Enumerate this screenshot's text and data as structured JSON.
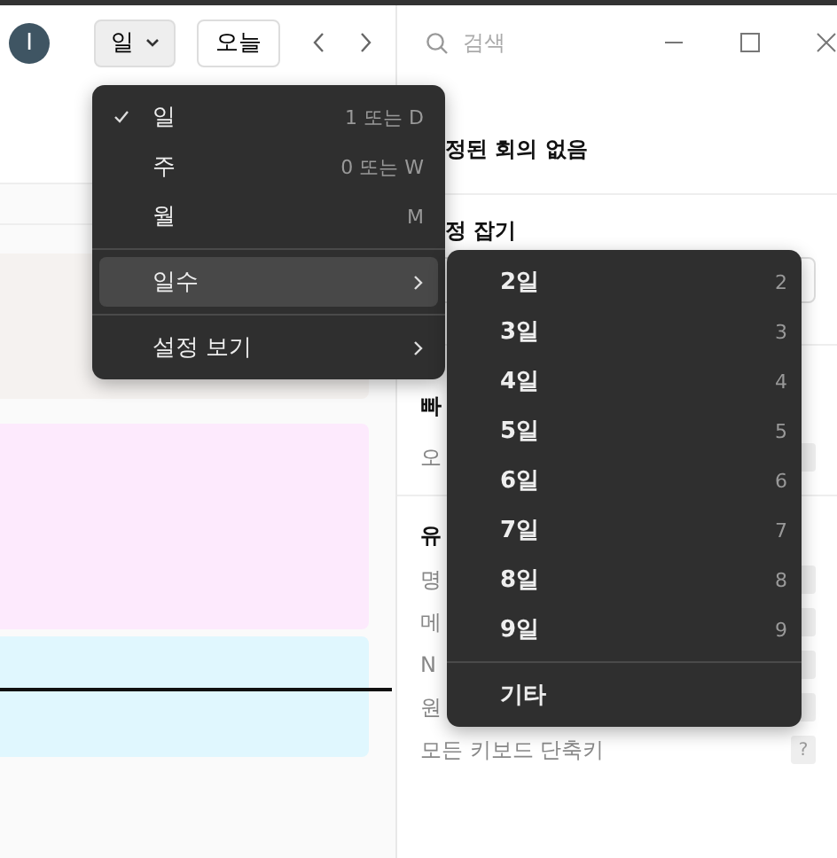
{
  "toolbar": {
    "avatar": "I",
    "view_button": "일",
    "today_button": "오늘"
  },
  "search": {
    "placeholder": "검색"
  },
  "calendar": {
    "events": [
      {
        "color": "#f5f2f0"
      },
      {
        "color": "#fdeafd"
      },
      {
        "color": "#e0f7fe"
      }
    ]
  },
  "side_panel": {
    "meetings_text": "정된 회의 없음",
    "schedule_heading": "정 잡기",
    "section_text": "빠",
    "section_item": "오",
    "shortcuts_heading": "유",
    "shortcuts": [
      {
        "label": "명"
      },
      {
        "label": "메"
      },
      {
        "label": "N"
      },
      {
        "label": "원"
      },
      {
        "label": "모든 키보드 단축키",
        "key": "?"
      }
    ]
  },
  "view_menu": {
    "items": [
      {
        "kind": "option",
        "label": "일",
        "shortcut": "1 또는 D",
        "checked": true,
        "selected": false,
        "divider_before": false
      },
      {
        "kind": "option",
        "label": "주",
        "shortcut": "0 또는 W",
        "checked": false,
        "selected": false,
        "divider_before": false
      },
      {
        "kind": "option",
        "label": "월",
        "shortcut": "M",
        "checked": false,
        "selected": false,
        "divider_before": false
      },
      {
        "kind": "submenu",
        "label": "일수",
        "checked": false,
        "selected": true,
        "divider_before": true
      },
      {
        "kind": "submenu",
        "label": "설정 보기",
        "checked": false,
        "selected": false,
        "divider_before": true
      }
    ]
  },
  "days_submenu": {
    "items": [
      {
        "label": "2일",
        "shortcut": "2"
      },
      {
        "label": "3일",
        "shortcut": "3"
      },
      {
        "label": "4일",
        "shortcut": "4"
      },
      {
        "label": "5일",
        "shortcut": "5"
      },
      {
        "label": "6일",
        "shortcut": "6"
      },
      {
        "label": "7일",
        "shortcut": "7"
      },
      {
        "label": "8일",
        "shortcut": "8"
      },
      {
        "label": "9일",
        "shortcut": "9"
      }
    ],
    "other": "기타"
  }
}
